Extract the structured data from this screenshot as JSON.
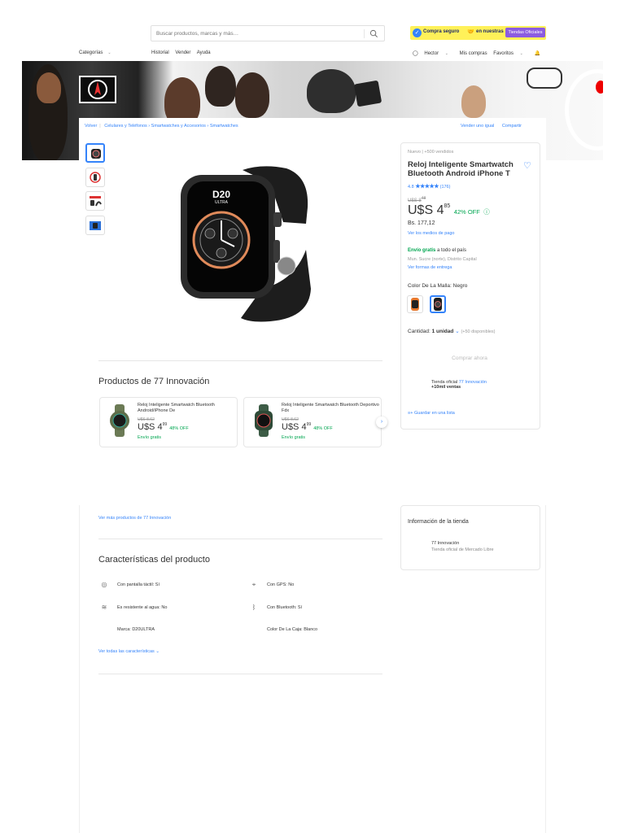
{
  "header": {
    "search_placeholder": "Buscar productos, marcas y más…",
    "promo": {
      "text1": "Compra seguro",
      "text2": "en nuestras",
      "tag": "Tiendas Oficiales"
    },
    "nav_left": [
      "Categorías",
      "Historial",
      "Vender",
      "Ayuda"
    ],
    "nav_right": {
      "user": "Hector",
      "purchases": "Mis compras",
      "favorites": "Favoritos"
    }
  },
  "breadcrumb": {
    "back": "Volver",
    "items": [
      "Celulares y Teléfonos",
      "Smartwatches y Accesorios",
      "Smartwatches"
    ],
    "sell_similar": "Vender uno igual",
    "share": "Compartir"
  },
  "product": {
    "condition_sales": "Nuevo | +500 vendidos",
    "title": "Reloj Inteligente Smartwatch Bluetooth Android iPhone T",
    "rating": "4.8",
    "stars": "★★★★★",
    "reviews": "(176)",
    "old_price": "U$S 8",
    "old_price_cents": "48",
    "price": "U$S 4",
    "price_cents": "85",
    "discount": "42% OFF",
    "bs_price": "Bs. 177,12",
    "payment_link": "Ver los medios de pago",
    "shipping_free": "Envío gratis",
    "shipping_rest": "a todo el país",
    "location": "Mun. Sucre (norte), Distrito Capital",
    "shipping_link": "Ver formas de entrega",
    "color_label": "Color De La Malla:",
    "color_value": "Negro",
    "quantity_label": "Cantidad:",
    "quantity_value": "1 unidad",
    "available": "(+50 disponibles)",
    "buy_button": "Comprar ahora",
    "store_label": "Tienda oficial",
    "store_name": "77 Innovación",
    "store_sales": "+10mil ventas",
    "save_list": "Guardar en una lista",
    "watch_brand": "D20",
    "watch_model": "ULTRA"
  },
  "related": {
    "heading": "Productos de 77 Innovación",
    "items": [
      {
        "name": "Reloj Inteligente Smartwatch Bluetooth Android/iPhone De",
        "old": "U$S 8,62",
        "price": "U$S 4",
        "cents": "99",
        "off": "48% OFF",
        "shipping": "Envío gratis"
      },
      {
        "name": "Reloj Inteligente Smartwatch Bluetooth Deportivo Fdx",
        "old": "U$S 8,62",
        "price": "U$S 4",
        "cents": "99",
        "off": "48% OFF",
        "shipping": "Envío gratis"
      }
    ],
    "more_link": "Ver más productos de 77 Innovación"
  },
  "store_info": {
    "heading": "Información de la tienda",
    "name": "77 Innovación",
    "desc": "Tienda oficial de Mercado Libre"
  },
  "features": {
    "heading": "Características del producto",
    "items": [
      {
        "icon": "touch-icon",
        "text": "Con pantalla táctil: Sí"
      },
      {
        "icon": "gps-icon",
        "text": "Con GPS: No"
      },
      {
        "icon": "water-icon",
        "text": "Es resistente al agua: No"
      },
      {
        "icon": "bluetooth-icon",
        "text": "Con Bluetooth: Sí"
      },
      {
        "icon": "",
        "text": "Marca: D20ULTRA"
      },
      {
        "icon": "",
        "text": "Color De La Caja: Blanco"
      }
    ],
    "all_link": "Ver todas las características"
  },
  "colors": {
    "accent": "#3483fa",
    "green": "#00a650",
    "promo_yellow": "#fff159",
    "tag_purple": "#8c5ce0"
  }
}
